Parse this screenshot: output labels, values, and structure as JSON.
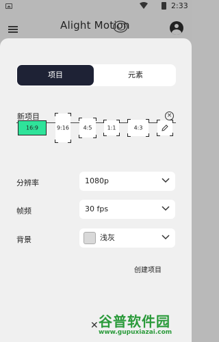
{
  "status_bar": {
    "time": "2:33"
  },
  "header": {
    "app_name": "Alight Motion"
  },
  "tabs": [
    {
      "label": "项目",
      "selected": true
    },
    {
      "label": "元素",
      "selected": false
    }
  ],
  "project_name": {
    "value": "新项目"
  },
  "aspect_ratios": [
    {
      "label": "16:9",
      "selected": true
    },
    {
      "label": "9:16",
      "selected": false
    },
    {
      "label": "4:5",
      "selected": false
    },
    {
      "label": "1:1",
      "selected": false
    },
    {
      "label": "4:3",
      "selected": false
    }
  ],
  "settings": {
    "resolution": {
      "label": "分辨率",
      "value": "1080p"
    },
    "frame_rate": {
      "label": "帧频",
      "value": "30 fps"
    },
    "background": {
      "label": "背景",
      "value": "浅灰",
      "swatch_color": "#d9d9d9"
    }
  },
  "actions": {
    "create_label": "创建项目"
  },
  "watermark": {
    "title": "谷普软件园",
    "url": "www.gupuxiazai.com"
  },
  "colors": {
    "accent": "#2fe39a",
    "tab_selected_bg": "#1e2235",
    "watermark": "#2a9a3a"
  }
}
